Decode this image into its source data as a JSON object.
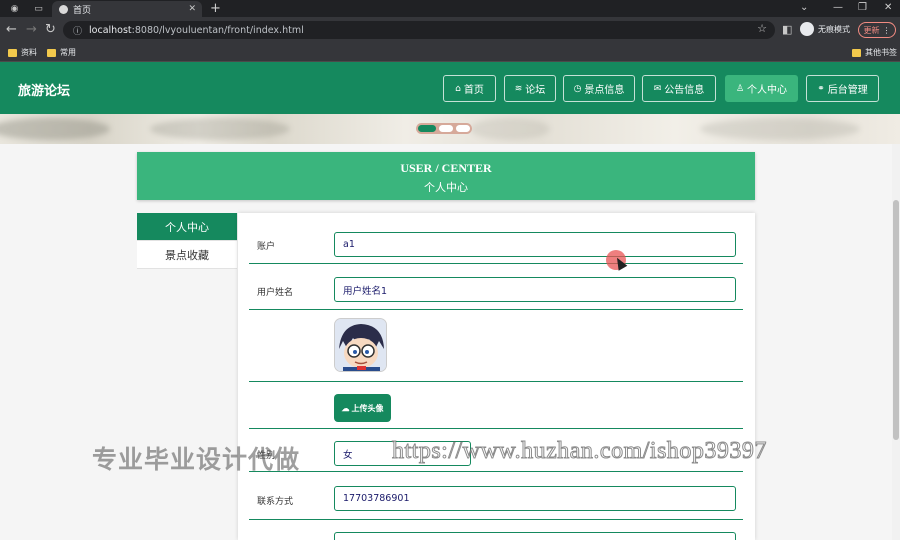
{
  "browser": {
    "tab_title": "首页",
    "url_host": "localhost",
    "url_rest": ":8080/lvyouluentan/front/index.html",
    "incognito_label": "无痕模式",
    "update_label": "更新",
    "bookmarks": [
      "资料",
      "常用"
    ],
    "other_bookmarks": "其他书签"
  },
  "site": {
    "title": "旅游论坛",
    "nav": [
      {
        "label": "首页",
        "icon": "home-icon"
      },
      {
        "label": "论坛",
        "icon": "layers-icon"
      },
      {
        "label": "景点信息",
        "icon": "clock-icon"
      },
      {
        "label": "公告信息",
        "icon": "mail-icon"
      },
      {
        "label": "个人中心",
        "icon": "user-icon",
        "active": true
      },
      {
        "label": "后台管理",
        "icon": "link-icon"
      }
    ],
    "carousel_active_index": 0,
    "carousel_count": 3
  },
  "user_center": {
    "title_en": "USER / CENTER",
    "title_zh": "个人中心",
    "sidebar": [
      "个人中心",
      "景点收藏"
    ],
    "fields": {
      "account_label": "账户",
      "account_value": "a1",
      "name_label": "用户姓名",
      "name_value": "用户姓名1",
      "upload_label": "上传头像",
      "gender_label": "性别",
      "gender_value": "女",
      "phone_label": "联系方式",
      "phone_value": "17703786901"
    }
  },
  "watermark": {
    "left": "专业毕业设计代做",
    "right": "https://www.huzhan.com/ishop39397"
  },
  "colors": {
    "primary": "#15895e",
    "accent": "#3ab57d",
    "chrome_dark": "#202124"
  }
}
